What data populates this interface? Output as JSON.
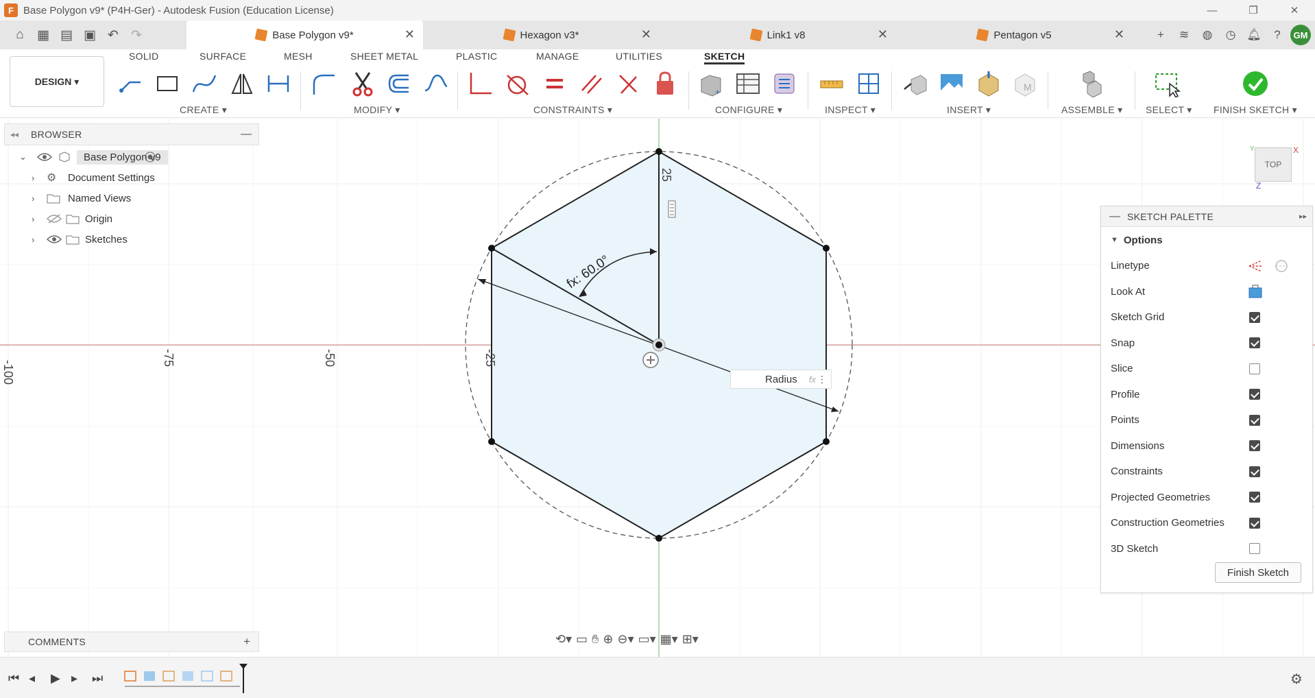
{
  "window": {
    "title": "Base Polygon v9* (P4H-Ger) - Autodesk Fusion (Education License)",
    "logo_letter": "F"
  },
  "tabs": [
    {
      "label": "Base Polygon v9*",
      "active": true
    },
    {
      "label": "Hexagon v3*",
      "active": false
    },
    {
      "label": "Link1 v8",
      "active": false
    },
    {
      "label": "Pentagon v5",
      "active": false
    }
  ],
  "user": {
    "initials": "GM"
  },
  "toolbar": {
    "design_label": "DESIGN",
    "workspace_tabs": [
      "SOLID",
      "SURFACE",
      "MESH",
      "SHEET METAL",
      "PLASTIC",
      "MANAGE",
      "UTILITIES",
      "SKETCH"
    ],
    "active_tab": "SKETCH",
    "groups": [
      "CREATE",
      "MODIFY",
      "CONSTRAINTS",
      "CONFIGURE",
      "INSPECT",
      "INSERT",
      "ASSEMBLE",
      "SELECT",
      "FINISH SKETCH"
    ]
  },
  "browser": {
    "title": "BROWSER",
    "root": "Base Polygon v9",
    "items": [
      "Document Settings",
      "Named Views",
      "Origin",
      "Sketches"
    ]
  },
  "comments": {
    "title": "COMMENTS"
  },
  "canvas": {
    "axis_labels": [
      "-100",
      "-75",
      "-50",
      "-25",
      "25"
    ],
    "angle_dim": "fx: 60.0°",
    "radius_label": "Radius",
    "fx_label": "fx",
    "viewcube": "TOP",
    "axis_x": "X",
    "axis_z": "Z",
    "colors": {
      "x_axis": "#c97a7a",
      "y_axis": "#5fc35f",
      "fill": "#e9f4fb"
    }
  },
  "palette": {
    "title": "SKETCH PALETTE",
    "section": "Options",
    "rows": [
      {
        "label": "Linetype",
        "type": "icon"
      },
      {
        "label": "Look At",
        "type": "icon"
      },
      {
        "label": "Sketch Grid",
        "checked": true
      },
      {
        "label": "Snap",
        "checked": true
      },
      {
        "label": "Slice",
        "checked": false
      },
      {
        "label": "Profile",
        "checked": true
      },
      {
        "label": "Points",
        "checked": true
      },
      {
        "label": "Dimensions",
        "checked": true
      },
      {
        "label": "Constraints",
        "checked": true
      },
      {
        "label": "Projected Geometries",
        "checked": true
      },
      {
        "label": "Construction Geometries",
        "checked": true
      },
      {
        "label": "3D Sketch",
        "checked": false
      }
    ],
    "finish_button": "Finish Sketch"
  }
}
